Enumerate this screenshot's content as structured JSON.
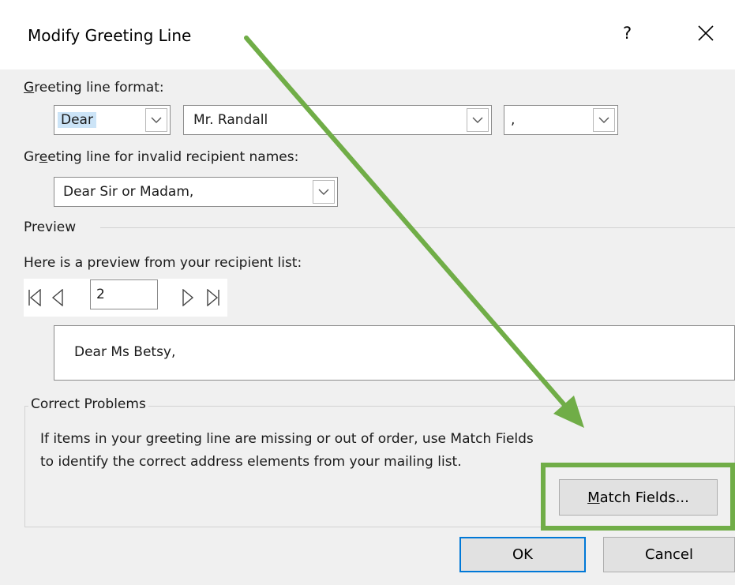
{
  "dialog": {
    "title": "Modify Greeting Line",
    "help_label": "?",
    "close_icon": "close-icon"
  },
  "greeting_format": {
    "label_accel": "G",
    "label_rest": "reeting line format:",
    "salutation": "Dear",
    "name_format": "Mr. Randall",
    "punctuation": ","
  },
  "invalid_names": {
    "label_pre": "Gr",
    "label_accel": "e",
    "label_rest": "eting line for invalid recipient names:",
    "value": "Dear Sir or Madam,"
  },
  "preview": {
    "section_label": "Preview",
    "intro": "Here is a preview from your recipient list:",
    "record_number": "2",
    "text": "Dear Ms Betsy,",
    "nav_icons": [
      "first-record-icon",
      "previous-record-icon",
      "next-record-icon",
      "last-record-icon"
    ]
  },
  "correct_problems": {
    "legend": "Correct Problems",
    "line1": "If items in your greeting line are missing or out of order, use Match Fields",
    "line2": "to identify the correct address elements from your mailing list.",
    "match_accel": "M",
    "match_rest": "atch Fields..."
  },
  "buttons": {
    "ok": "OK",
    "cancel": "Cancel"
  },
  "annotation": {
    "color": "#70ad47",
    "accent": "#0078d7"
  }
}
